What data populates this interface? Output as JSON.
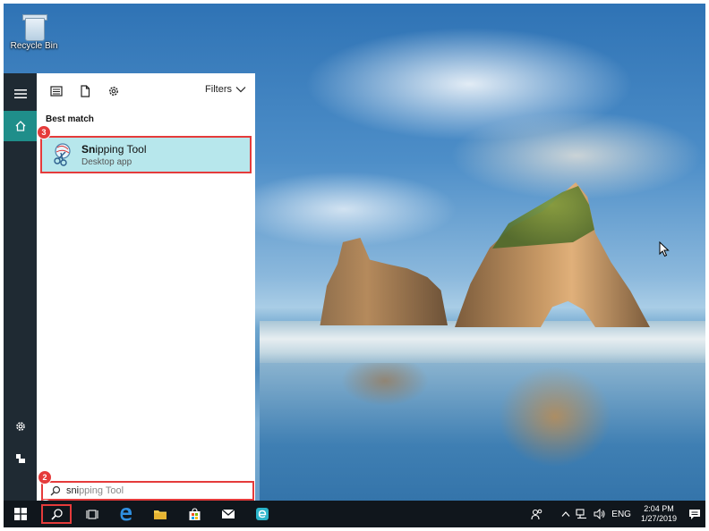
{
  "desktop": {
    "icons": [
      {
        "label": "Recycle Bin"
      }
    ]
  },
  "start_menu": {
    "toolbar": {
      "filters_label": "Filters"
    },
    "results": {
      "heading": "Best match",
      "best_match": {
        "title_bold": "Sn",
        "title_rest": "ipping Tool",
        "subtitle": "Desktop app"
      }
    },
    "search": {
      "typed_text": "sni",
      "suggestion_text": "pping Tool"
    }
  },
  "steps": [
    "1",
    "2",
    "3"
  ],
  "taskbar": {
    "tray": {
      "language": "ENG",
      "time": "2:04 PM",
      "date": "1/27/2019"
    }
  },
  "colors": {
    "highlight": "#b7e7ec",
    "annotation_red": "#e53b3b",
    "rail_home": "#1f8e8a",
    "taskbar": "#10161c"
  }
}
